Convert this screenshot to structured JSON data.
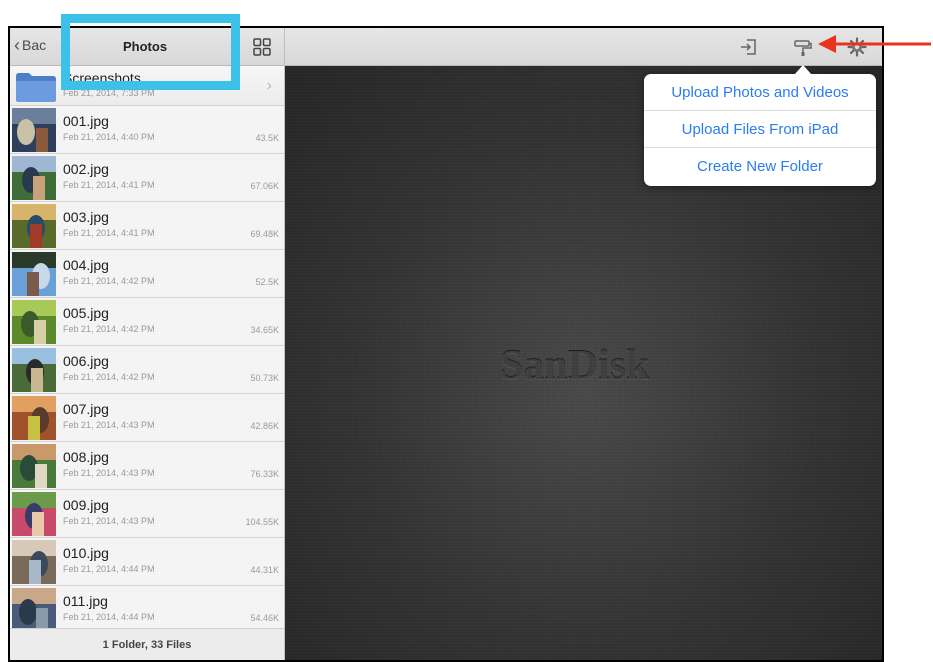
{
  "topbar": {
    "back_label": "Bac",
    "title": "Photos",
    "icons": [
      "grid-icon",
      "import-icon",
      "paint-roller-icon",
      "gear-icon"
    ]
  },
  "folder": {
    "name": "Screenshots",
    "date": "Feb 21, 2014, 7:33 PM"
  },
  "files": [
    {
      "name": "001.jpg",
      "date": "Feb 21, 2014, 4:40 PM",
      "size": "43.5K"
    },
    {
      "name": "002.jpg",
      "date": "Feb 21, 2014, 4:41 PM",
      "size": "67.06K"
    },
    {
      "name": "003.jpg",
      "date": "Feb 21, 2014, 4:41 PM",
      "size": "69.48K"
    },
    {
      "name": "004.jpg",
      "date": "Feb 21, 2014, 4:42 PM",
      "size": "52.5K"
    },
    {
      "name": "005.jpg",
      "date": "Feb 21, 2014, 4:42 PM",
      "size": "34.65K"
    },
    {
      "name": "006.jpg",
      "date": "Feb 21, 2014, 4:42 PM",
      "size": "50.73K"
    },
    {
      "name": "007.jpg",
      "date": "Feb 21, 2014, 4:43 PM",
      "size": "42.86K"
    },
    {
      "name": "008.jpg",
      "date": "Feb 21, 2014, 4:43 PM",
      "size": "76.33K"
    },
    {
      "name": "009.jpg",
      "date": "Feb 21, 2014, 4:43 PM",
      "size": "104.55K"
    },
    {
      "name": "010.jpg",
      "date": "Feb 21, 2014, 4:44 PM",
      "size": "44.31K"
    },
    {
      "name": "011.jpg",
      "date": "Feb 21, 2014, 4:44 PM",
      "size": "54.46K"
    }
  ],
  "footer": {
    "summary": "1 Folder, 33 Files"
  },
  "brand": "SanDisk",
  "popover": {
    "items": [
      "Upload Photos and Videos",
      "Upload Files From iPad",
      "Create New Folder"
    ]
  },
  "colors": {
    "highlight": "#3cc1e8",
    "arrow": "#e8331d",
    "link_blue": "#2a7df0"
  }
}
